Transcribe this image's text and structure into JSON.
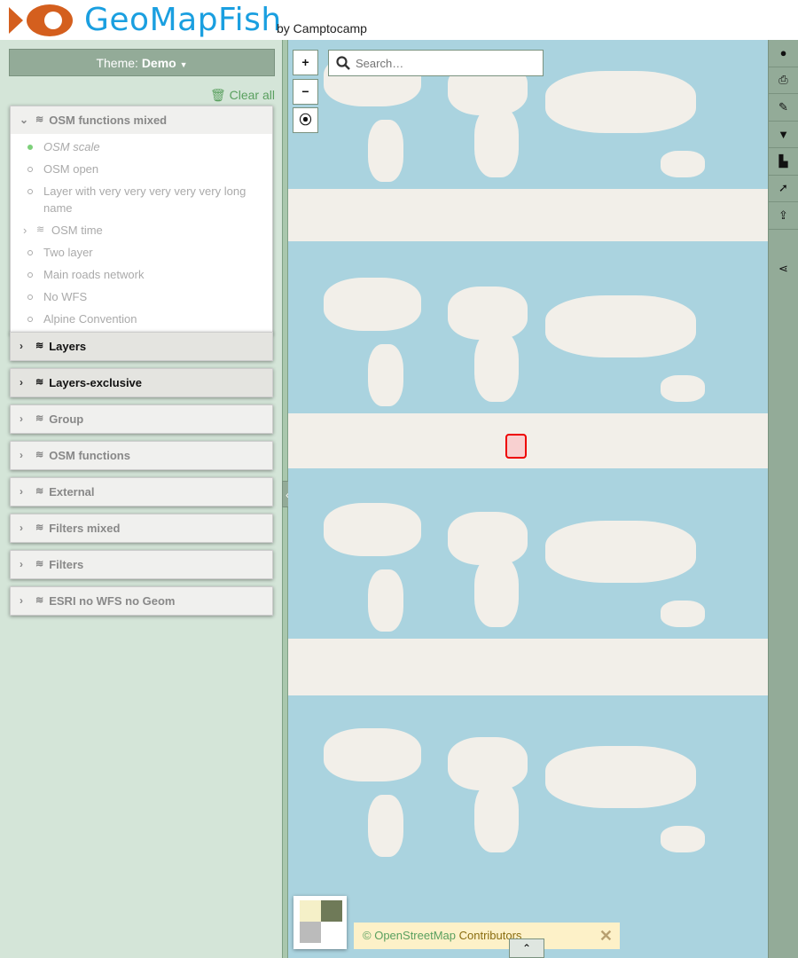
{
  "header": {
    "brand": "GeoMapFish",
    "byline": "by Camptocamp",
    "logo_color": "#d45f1e",
    "brand_color": "#1a9fe0"
  },
  "sidebar": {
    "theme_label": "Theme:",
    "theme_value": "Demo",
    "clear_all": "Clear all",
    "groups": [
      {
        "label": "OSM functions mixed",
        "expanded": true,
        "items": [
          {
            "label": "OSM scale",
            "active": true
          },
          {
            "label": "OSM open"
          },
          {
            "label": "Layer with very very very very very long name"
          },
          {
            "label": "OSM time",
            "group": true
          },
          {
            "label": "Two layer"
          },
          {
            "label": "Main roads network"
          },
          {
            "label": "No WFS"
          },
          {
            "label": "Alpine Convention"
          }
        ]
      },
      {
        "label": "Layers"
      },
      {
        "label": "Layers-exclusive"
      },
      {
        "label": "Group"
      },
      {
        "label": "OSM functions"
      },
      {
        "label": "External"
      },
      {
        "label": "Filters mixed"
      },
      {
        "label": "Filters"
      },
      {
        "label": "ESRI no WFS no Geom"
      }
    ]
  },
  "map": {
    "zoom_in": "+",
    "zoom_out": "−",
    "search_placeholder": "Search…",
    "attribution": {
      "prefix": "©",
      "link": "OpenStreetMap",
      "suffix": "Contributors"
    }
  },
  "toolbar": [
    "user-icon",
    "print-icon",
    "draw-icon",
    "filter-icon",
    "profile-icon",
    "query-icon",
    "import-icon",
    "share-icon"
  ]
}
